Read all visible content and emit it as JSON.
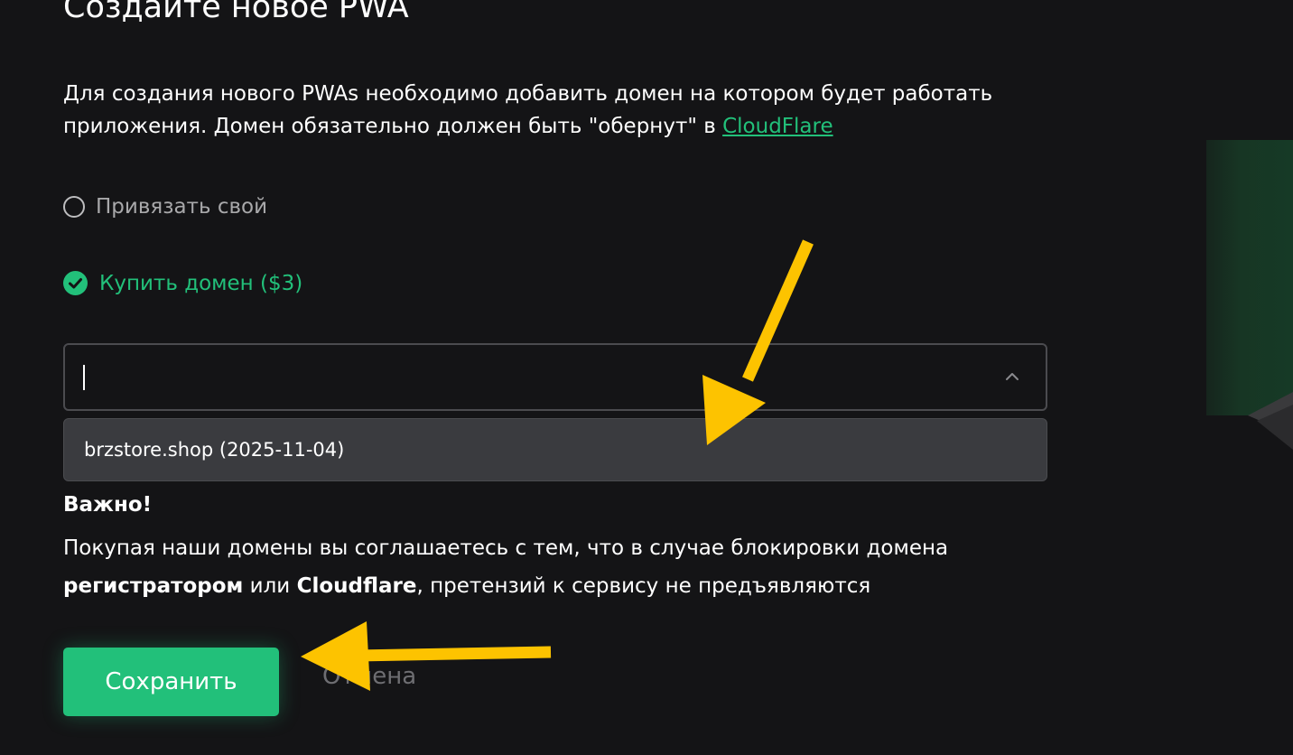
{
  "page": {
    "title": "Создайте новое PWA",
    "description_text": "Для создания нового PWAs необходимо добавить домен на котором будет работать приложения. Домен обязательно должен быть \"обернут\" в ",
    "description_link": "CloudFlare"
  },
  "domain_options": {
    "own_label": "Привязать свой",
    "buy_label": "Купить домен ($3)",
    "selected": "buy"
  },
  "domain_select": {
    "value": "",
    "options": [
      "brzstore.shop (2025-11-04)"
    ]
  },
  "important": {
    "title": "Важно!",
    "text_1": "Покупая наши домены вы соглашаетесь с тем, что в случае блокировки домена ",
    "bold_1": "регистратором",
    "text_2": " или ",
    "bold_2": "Cloudflare",
    "text_3": ", претензий к сервису не предъявляются"
  },
  "actions": {
    "save_label": "Сохранить",
    "cancel_label": "Отмена"
  },
  "colors": {
    "background": "#141416",
    "accent": "#22c07a",
    "annotation_arrow": "#fdc300",
    "dropdown": "#3a3b3f"
  },
  "icons": {
    "radio_unchecked": "radio-unchecked-icon",
    "radio_checked": "check-circle-icon",
    "chevron": "chevron-up-icon"
  }
}
